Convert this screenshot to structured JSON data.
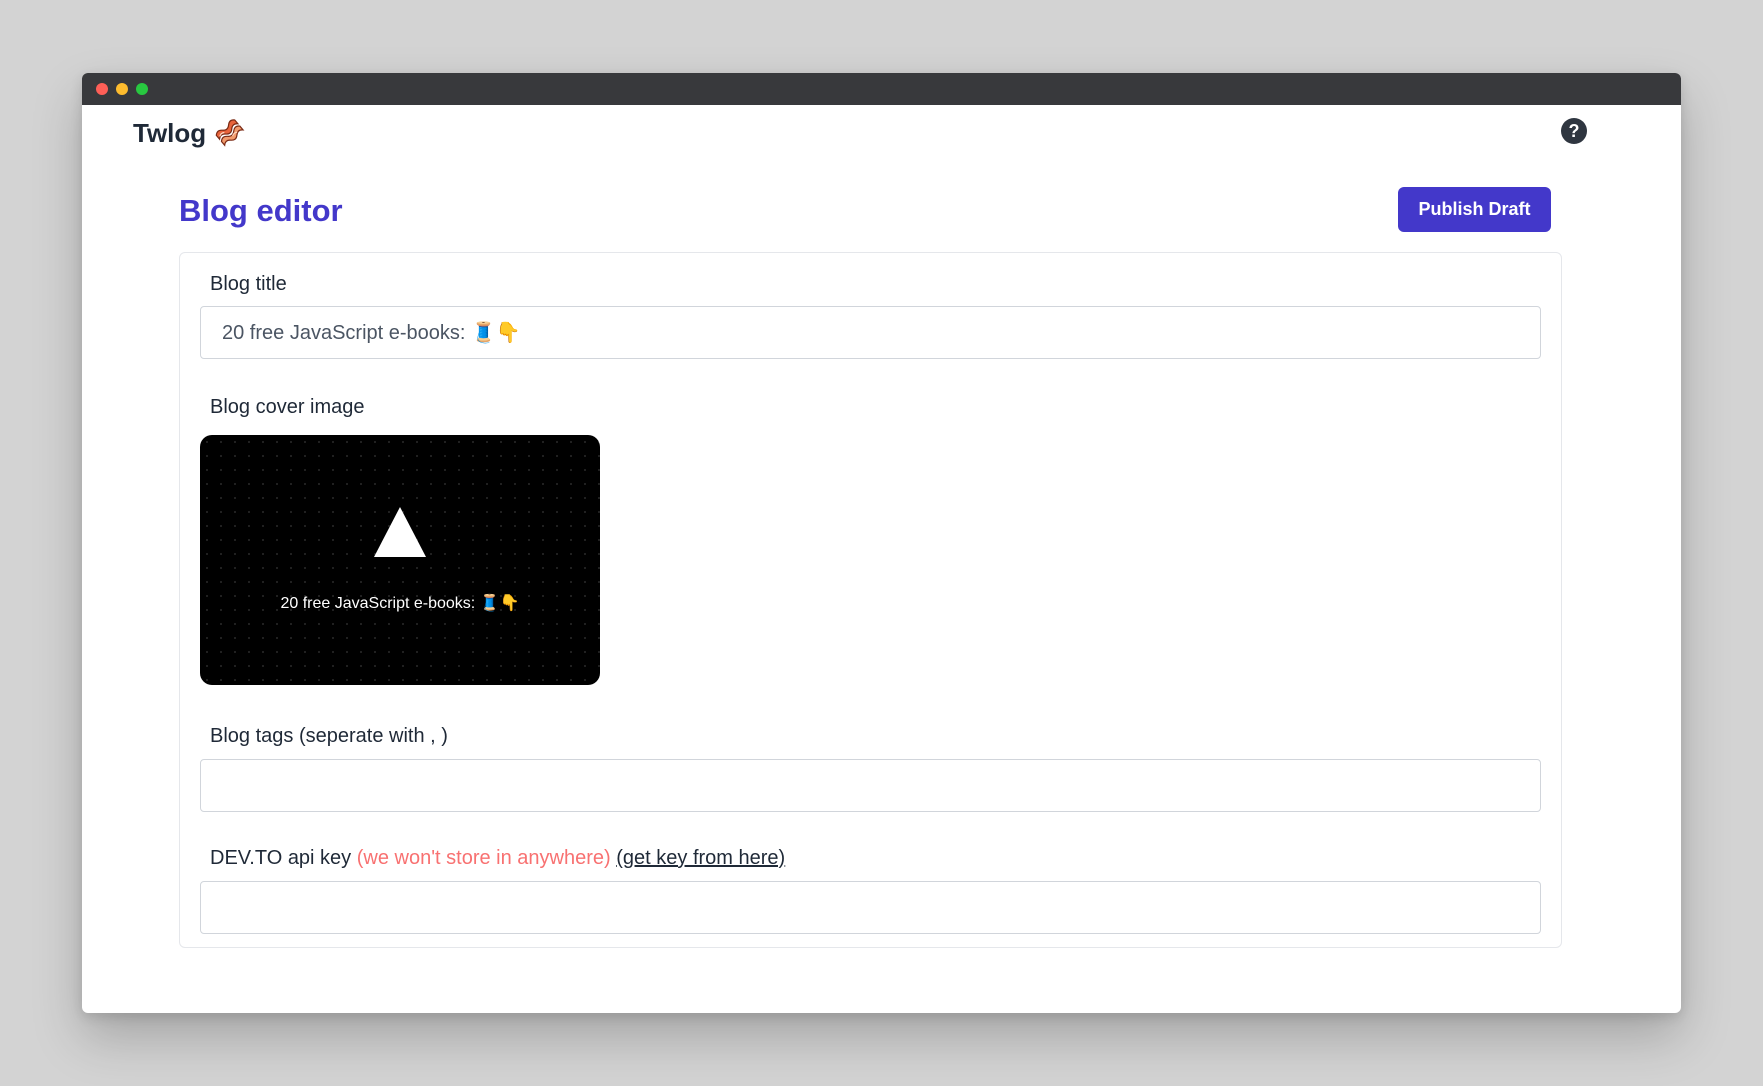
{
  "window": {
    "controls": [
      "close",
      "minimize",
      "maximize"
    ]
  },
  "header": {
    "brand_name": "Twlog",
    "brand_icon": "bacon-icon",
    "help_icon": "question-circle-icon",
    "help_glyph": "?"
  },
  "editor": {
    "title": "Blog editor",
    "publish_label": "Publish Draft"
  },
  "form": {
    "title_label": "Blog title",
    "title_value": "20 free JavaScript e-books: 🧵👇",
    "cover_label": "Blog cover image",
    "cover_caption": "20 free JavaScript e-books: 🧵👇",
    "tags_label": "Blog tags (seperate with , )",
    "tags_value": "",
    "api_label": "DEV.TO api key",
    "api_hint": "(we won't store in anywhere)",
    "api_link": "(get key from here)",
    "api_value": ""
  },
  "colors": {
    "accent": "#4338ca",
    "hint": "#f87171",
    "titlebar": "#38393c"
  }
}
